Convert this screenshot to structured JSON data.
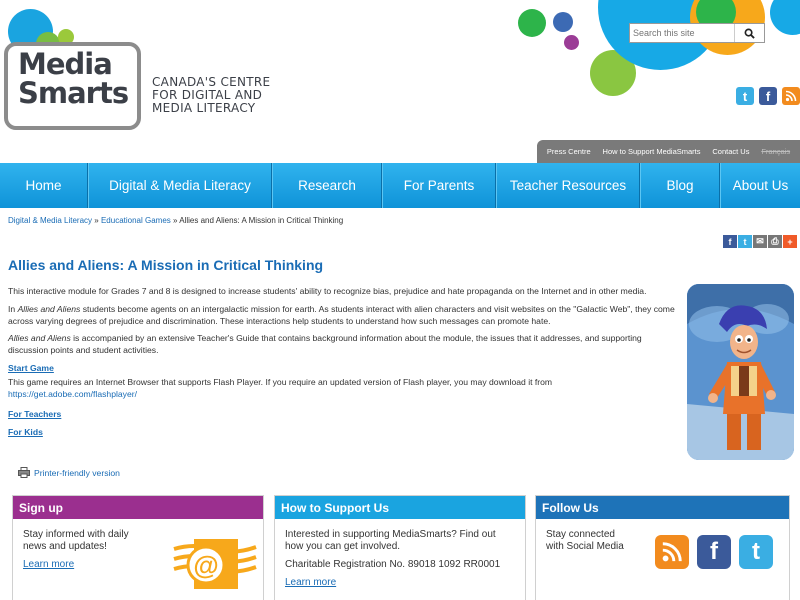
{
  "header": {
    "logo_line1": "Media",
    "logo_line2": "Smarts",
    "tagline": [
      "CANADA'S CENTRE",
      "FOR DIGITAL AND",
      "MEDIA LITERACY"
    ],
    "search_placeholder": "Search this site",
    "social_icons": [
      "twitter-icon",
      "facebook-icon",
      "rss-icon"
    ],
    "top_links": [
      "Press Centre",
      "How to Support MediaSmarts",
      "Contact Us",
      "Français"
    ]
  },
  "nav": {
    "items": [
      "Home",
      "Digital & Media Literacy",
      "Research",
      "For Parents",
      "Teacher Resources",
      "Blog",
      "About Us"
    ]
  },
  "breadcrumb": {
    "link1": "Digital & Media Literacy",
    "sep": "»",
    "link2": "Educational Games",
    "current": "Allies and Aliens: A Mission in Critical Thinking"
  },
  "share_icons": [
    "facebook-icon",
    "twitter-icon",
    "email-icon",
    "print-icon",
    "plus-icon"
  ],
  "article": {
    "title": "Allies and Aliens: A Mission in Critical Thinking",
    "p1": "This interactive module for Grades 7 and 8 is designed to increase students' ability to recognize bias, prejudice and hate propaganda on the Internet and in other media.",
    "p2_em": "Allies and Aliens",
    "p2_pre": "In ",
    "p2_rest": " students become agents on an intergalactic mission for earth. As students interact with alien characters and visit websites on the \"Galactic Web\", they come across varying degrees of prejudice and discrimination. These interactions help students to understand how such messages can promote hate.",
    "p3_em": "Allies and Aliens",
    "p3_rest": " is accompanied by an extensive Teacher's Guide that contains background information about the module, the issues that it addresses, and supporting discussion points and student activities.",
    "start_game": "Start Game",
    "flash_note": "This game requires an Internet Browser that supports Flash Player. If you require an updated version of Flash player, you may download it from",
    "flash_link": "https://get.adobe.com/flashplayer/",
    "for_teachers": "For Teachers",
    "for_kids": "For Kids",
    "printer": "Printer-friendly version"
  },
  "boxes": {
    "signup": {
      "title": "Sign up",
      "text": "Stay informed with daily news and updates!",
      "link": "Learn more",
      "color": "#9b2f8f"
    },
    "support": {
      "title": "How to Support Us",
      "text": "Interested in supporting MediaSmarts? Find out how you can get involved.",
      "reg": "Charitable Registration No. 89018 1092 RR0001",
      "link": "Learn more",
      "color": "#1aa4e0"
    },
    "follow": {
      "title": "Follow Us",
      "text": "Stay connected with Social Media",
      "icons": [
        "rss-icon",
        "facebook-icon",
        "twitter-icon"
      ],
      "color": "#1e73b8"
    }
  }
}
